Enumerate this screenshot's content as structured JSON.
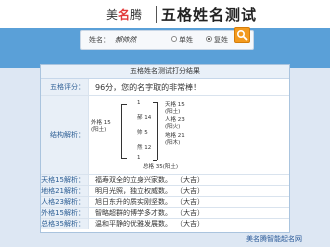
{
  "header": {
    "logo_prefix": "美",
    "logo_mid": "名",
    "logo_suffix": "腾",
    "site_title": "五格姓名测试"
  },
  "search": {
    "name_label": "姓名：",
    "name_value": "郝帅然",
    "options": [
      {
        "label": "单姓",
        "selected": false
      },
      {
        "label": "复姓",
        "selected": true
      }
    ],
    "button_icon": "search-icon"
  },
  "result": {
    "title": "五格姓名测试打分结果",
    "score_label": "五格评分：",
    "score_text": "96分，您的名字取的非常棒！",
    "structure_label": "结构解析：",
    "structure": {
      "outer": "外格 15\n(阳土)",
      "char1": "郝 14",
      "char2": "帅 5",
      "char3": "然 12",
      "top_num": "1",
      "bottom_num": "1",
      "tiange": "天格 15\n(阳土)",
      "renge": "人格 23\n(阳火)",
      "dige": "地格 21\n(阳木)",
      "zongge": "总格 35(阳土)"
    },
    "rows": [
      {
        "label": "天格15解析：",
        "text": "福寿双全的立身兴家数。",
        "tag": "（大吉）"
      },
      {
        "label": "地格21解析：",
        "text": "明月光照，独立权威数。",
        "tag": "（大吉）"
      },
      {
        "label": "人格23解析：",
        "text": "旭日东升的质实刚坚数。",
        "tag": "（大吉）"
      },
      {
        "label": "外格15解析：",
        "text": "智略超群的博学多才数。",
        "tag": "（大吉）"
      },
      {
        "label": "总格35解析：",
        "text": "温和平静的优雅发展数。",
        "tag": "（大吉）"
      }
    ]
  },
  "footer": {
    "link_text": "美名腾智能起名网"
  }
}
